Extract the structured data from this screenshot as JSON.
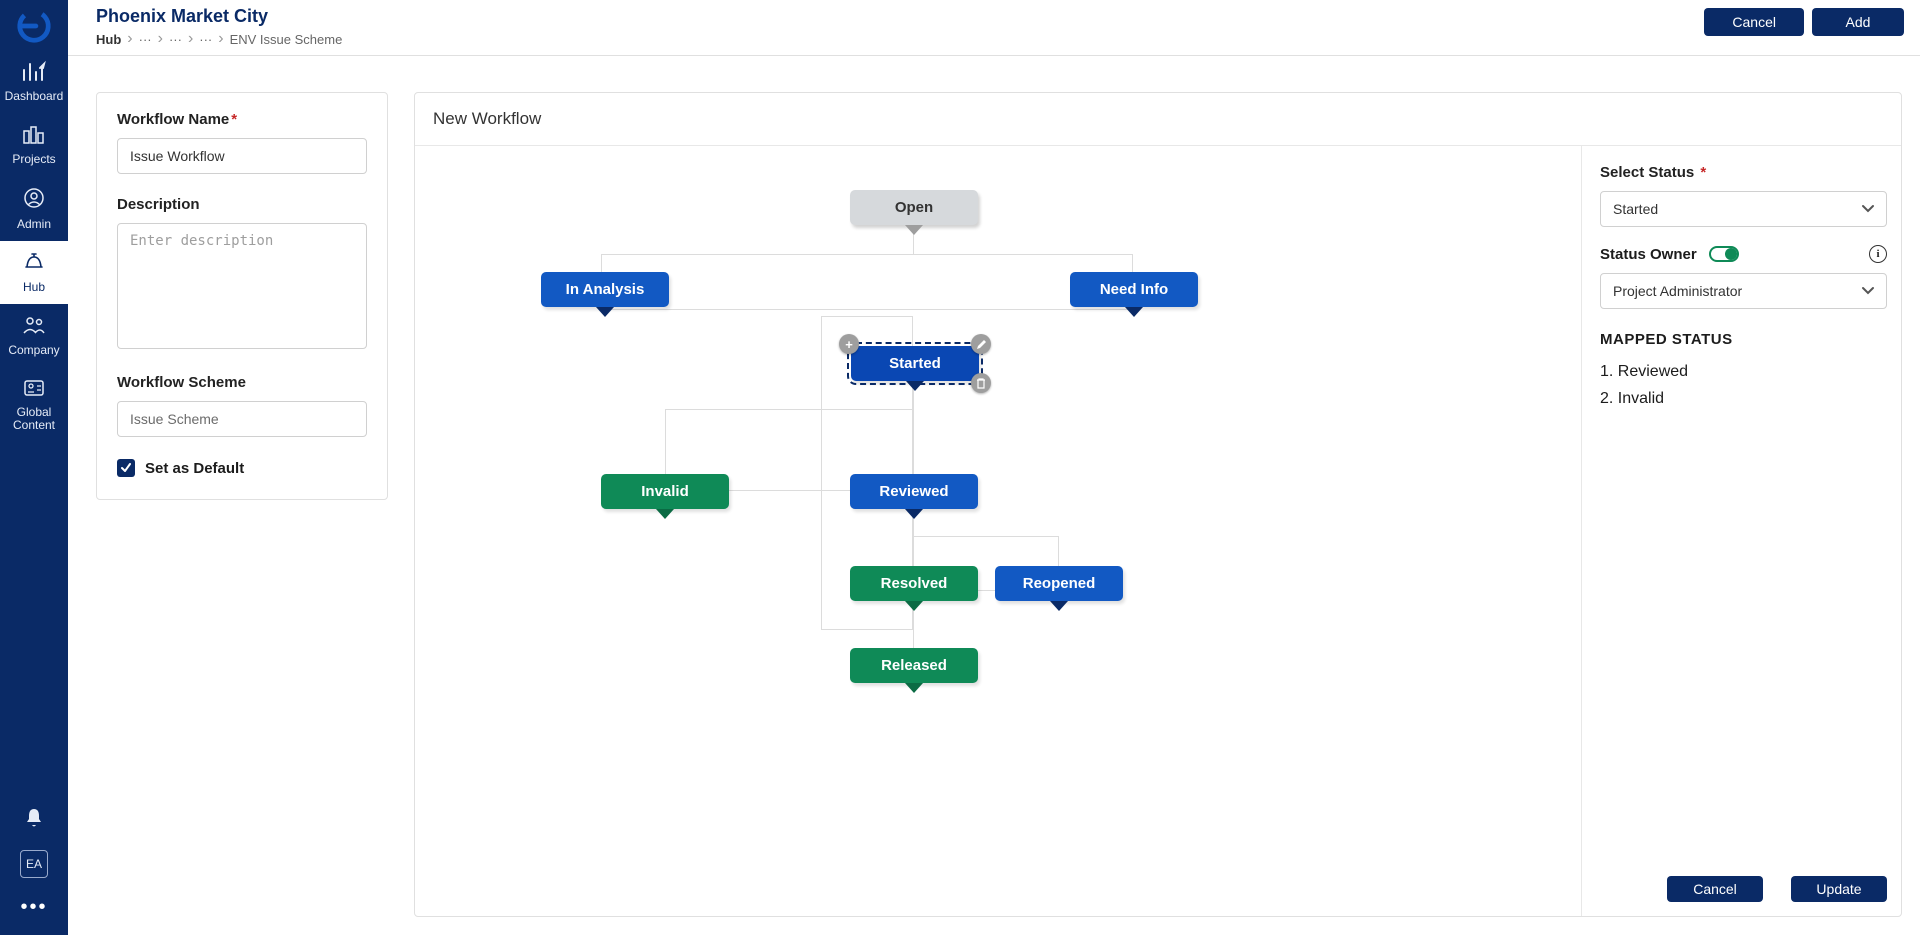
{
  "sidebar": {
    "items": [
      {
        "label": "Dashboard"
      },
      {
        "label": "Projects"
      },
      {
        "label": "Admin"
      },
      {
        "label": "Hub"
      },
      {
        "label": "Company"
      },
      {
        "label": "Global Content"
      }
    ],
    "avatar": "EA"
  },
  "header": {
    "title": "Phoenix Market City",
    "breadcrumb": {
      "root": "Hub",
      "leaf": "ENV Issue Scheme"
    },
    "actions": {
      "cancel": "Cancel",
      "add": "Add"
    }
  },
  "form": {
    "workflow_name_label": "Workflow Name",
    "workflow_name_value": "Issue Workflow",
    "description_label": "Description",
    "description_placeholder": "Enter description",
    "workflow_scheme_label": "Workflow Scheme",
    "workflow_scheme_value": "Issue Scheme",
    "set_default_label": "Set as Default"
  },
  "canvas": {
    "title": "New Workflow",
    "nodes": {
      "open": "Open",
      "in_analysis": "In Analysis",
      "need_info": "Need Info",
      "started": "Started",
      "invalid": "Invalid",
      "reviewed": "Reviewed",
      "resolved": "Resolved",
      "reopened": "Reopened",
      "released": "Released"
    }
  },
  "status_panel": {
    "select_status_label": "Select Status",
    "select_status_value": "Started",
    "status_owner_label": "Status Owner",
    "status_owner_value": "Project Administrator",
    "mapped_title": "MAPPED STATUS",
    "mapped": [
      "Reviewed",
      "Invalid"
    ],
    "cancel": "Cancel",
    "update": "Update"
  }
}
